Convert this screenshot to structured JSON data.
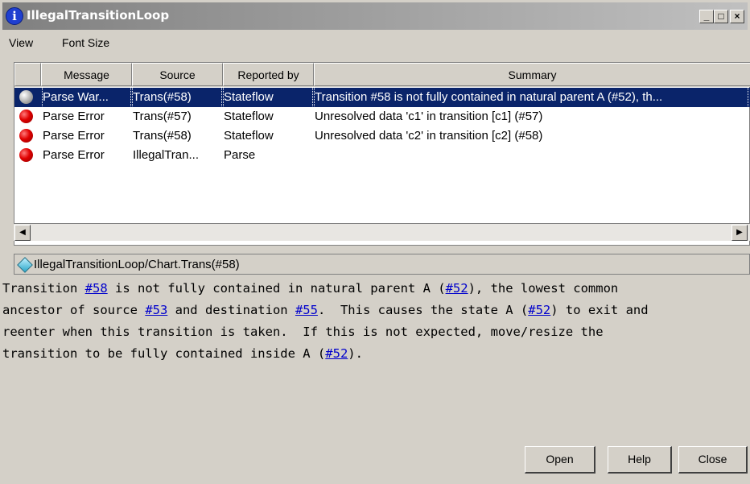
{
  "window": {
    "title": "IllegalTransitionLoop",
    "minimize_label": "_",
    "maximize_label": "□",
    "close_label": "×"
  },
  "menu": {
    "items": [
      "View",
      "Font Size"
    ]
  },
  "table": {
    "columns": [
      "Message",
      "Source",
      "Reported by",
      "Summary"
    ],
    "rows": [
      {
        "severity": "warning",
        "message": "Parse War...",
        "source": "Trans(#58)",
        "reported_by": "Stateflow",
        "summary": "Transition #58 is not fully contained in natural parent A (#52), th...",
        "selected": true
      },
      {
        "severity": "error",
        "message": "Parse Error",
        "source": "Trans(#57)",
        "reported_by": "Stateflow",
        "summary": "Unresolved data 'c1' in transition [c1] (#57)"
      },
      {
        "severity": "error",
        "message": "Parse Error",
        "source": "Trans(#58)",
        "reported_by": "Stateflow",
        "summary": "Unresolved data 'c2' in transition [c2] (#58)"
      },
      {
        "severity": "error",
        "message": "Parse Error",
        "source": "IllegalTran...",
        "reported_by": "Parse",
        "summary": ""
      }
    ]
  },
  "scrollbar": {
    "left_arrow": "◀",
    "right_arrow": "▶"
  },
  "path": {
    "text": "IllegalTransitionLoop/Chart.Trans(#58)"
  },
  "detail": {
    "l1_a": "Transition ",
    "l1_link1": "#58",
    "l1_b": " is not fully contained in natural parent A (",
    "l1_link2": "#52",
    "l1_c": "), the lowest common",
    "l2_a": "ancestor of source ",
    "l2_link1": "#53",
    "l2_b": " and destination ",
    "l2_link2": "#55",
    "l2_c": ".  This causes the state A (",
    "l2_link3": "#52",
    "l2_d": ") to exit and",
    "l3": "reenter when this transition is taken.  If this is not expected, move/resize the",
    "l4_a": "transition to be fully contained inside A (",
    "l4_link": "#52",
    "l4_b": ")."
  },
  "buttons": {
    "open": "Open",
    "help": "Help",
    "close": "Close"
  }
}
